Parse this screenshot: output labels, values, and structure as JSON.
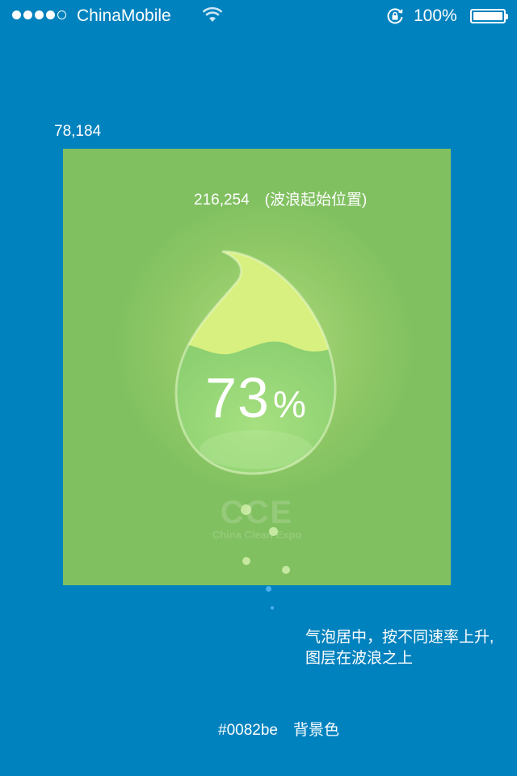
{
  "status_bar": {
    "carrier": "ChinaMobile",
    "signal_bars_filled": 4,
    "signal_bars_total": 5,
    "battery_text": "100%",
    "battery_level": 1.0,
    "icons": [
      "wifi-icon",
      "rotation-lock-icon",
      "battery-icon"
    ]
  },
  "annotations": {
    "panel_origin": "78,184",
    "wave_origin": "216,254　(波浪起始位置)",
    "bubble_note_line1": "气泡居中，按不同速率上升,",
    "bubble_note_line2": "图层在波浪之上",
    "background_note": "#0082be　背景色"
  },
  "gauge": {
    "percent_value": "73",
    "percent_unit": "%",
    "fill_level": 0.73
  },
  "logo": {
    "mark": "CCE",
    "subtitle": "China Clean Expo"
  },
  "colors": {
    "background": "#0082be",
    "panel": "#80c060",
    "drop_top": "#d8f080",
    "drop_water": "#98d878"
  }
}
